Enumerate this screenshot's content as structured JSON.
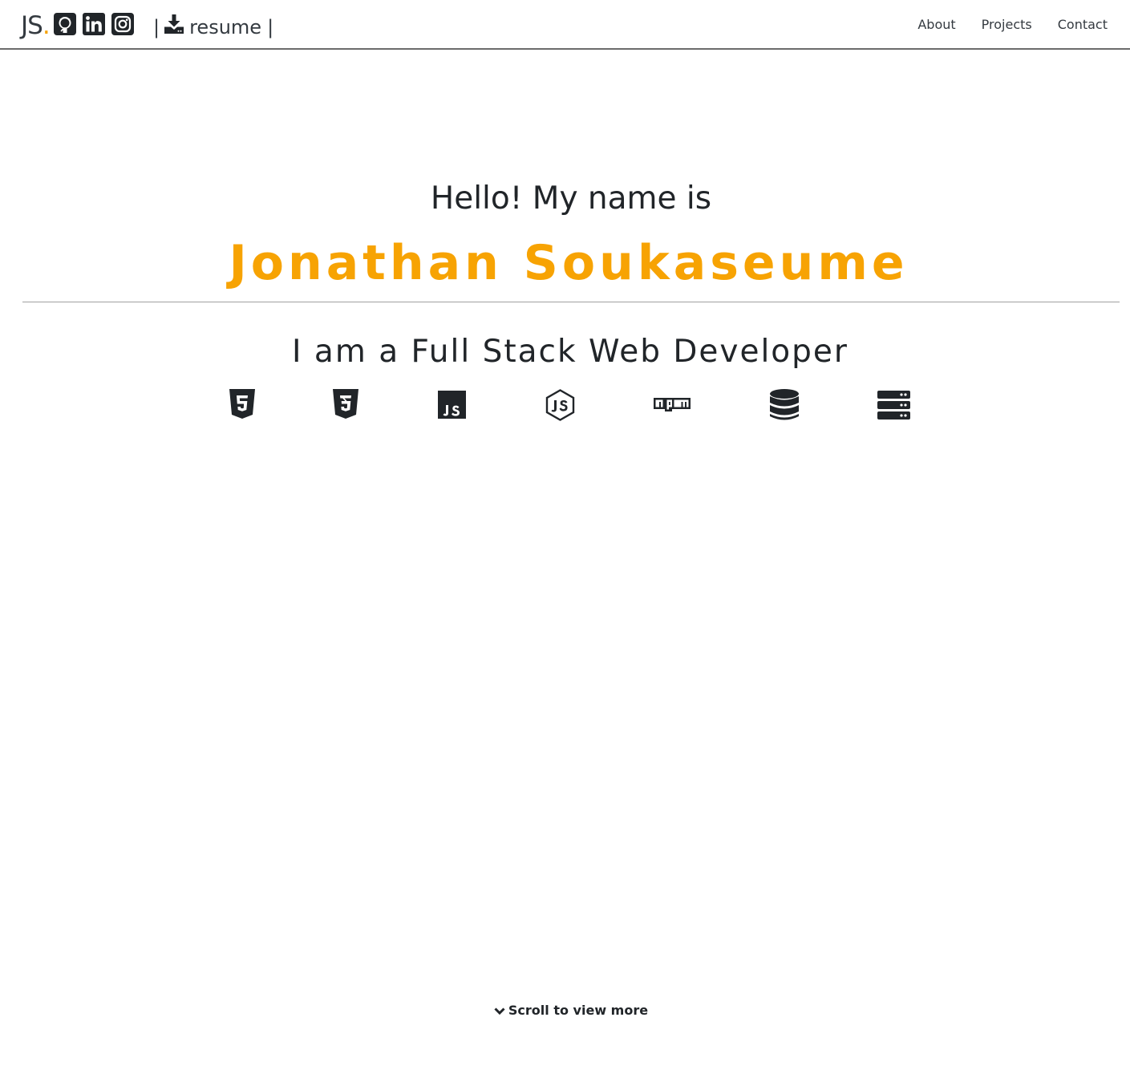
{
  "navbar": {
    "brand_initials": "JS",
    "brand_dot": ".",
    "social_icons": [
      "github-icon",
      "linkedin-icon",
      "instagram-icon"
    ],
    "resume_pipe_left": "|",
    "resume_label": "resume",
    "resume_pipe_right": "|",
    "resume_icon": "download-icon",
    "links": [
      "About",
      "Projects",
      "Contact"
    ]
  },
  "hero": {
    "greeting": "Hello! My name is",
    "name": "Jonathan Soukaseume",
    "role": "I am a Full Stack Web Developer",
    "tech_icons": [
      "html5-icon",
      "css3-icon",
      "javascript-icon",
      "nodejs-icon",
      "npm-icon",
      "database-icon",
      "server-icon"
    ]
  },
  "footer": {
    "scroll_label": "Scroll to view more",
    "scroll_icon": "chevron-down-icon"
  },
  "colors": {
    "accent": "#f7a303",
    "text": "#212529",
    "icon": "#212529",
    "divider": "#a0a0a0"
  }
}
